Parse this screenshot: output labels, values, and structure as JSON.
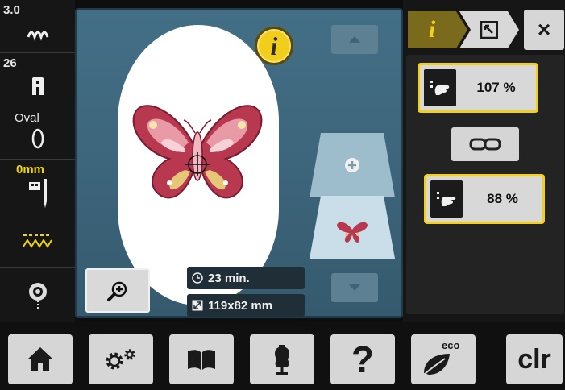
{
  "sidebar": {
    "items": [
      {
        "label": "3.0",
        "icon": "stitch-length-icon"
      },
      {
        "label": "26",
        "icon": "presser-foot-icon"
      },
      {
        "label": "Oval",
        "icon": "hoop-icon"
      },
      {
        "label": "0mm",
        "icon": "needle-position-icon"
      },
      {
        "label": "",
        "icon": "stitch-pattern-icon"
      },
      {
        "label": "",
        "icon": "bobbin-icon"
      }
    ]
  },
  "main": {
    "info_glyph": "i",
    "time": "23 min.",
    "size": "119x82 mm"
  },
  "right_panel": {
    "tab_info_glyph": "i",
    "close_glyph": "×",
    "width_value": "107 %",
    "height_value": "88 %"
  },
  "bottom_bar": {
    "help_glyph": "?",
    "eco_label": "eco",
    "clr_label": "clr"
  },
  "colors": {
    "accent_yellow": "#f1cf1a",
    "panel_blue": "#436f86",
    "button_gray": "#d6d6d6"
  }
}
